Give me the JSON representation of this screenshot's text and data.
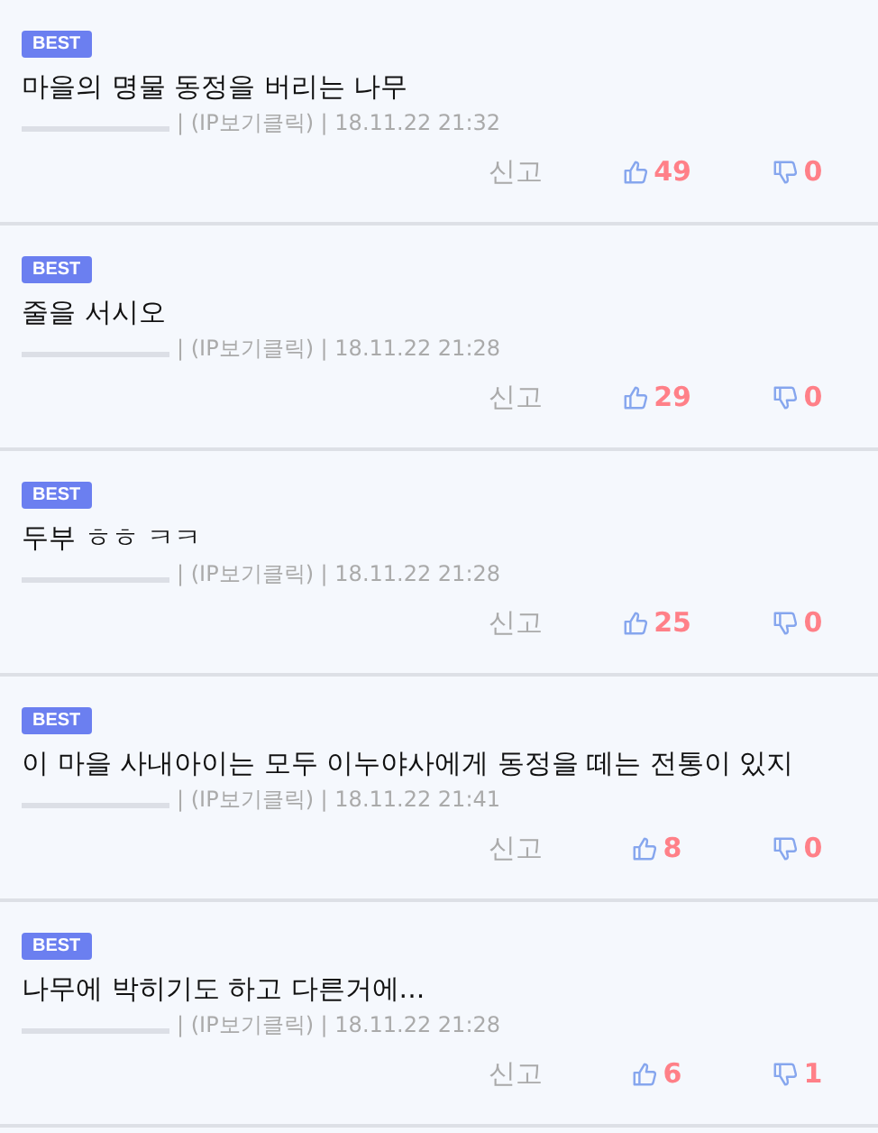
{
  "comments": [
    {
      "badge": "BEST",
      "text": "마을의 명물 동정을 버리는 나무",
      "meta": "| (IP보기클릭) | 18.11.22 21:32",
      "report": "신고",
      "likes": "49",
      "dislikes": "0"
    },
    {
      "badge": "BEST",
      "text": "줄을 서시오",
      "meta": "| (IP보기클릭) | 18.11.22 21:28",
      "report": "신고",
      "likes": "29",
      "dislikes": "0"
    },
    {
      "badge": "BEST",
      "text": "두부 ㅎㅎ ㅋㅋ",
      "meta": "| (IP보기클릭) | 18.11.22 21:28",
      "report": "신고",
      "likes": "25",
      "dislikes": "0"
    },
    {
      "badge": "BEST",
      "text": "이 마을 사내아이는 모두 이누야사에게 동정을 떼는 전통이 있지",
      "meta": "| (IP보기클릭) | 18.11.22 21:41",
      "report": "신고",
      "likes": "8",
      "dislikes": "0"
    },
    {
      "badge": "BEST",
      "text": "나무에 박히기도 하고 다른거에...",
      "meta": "| (IP보기클릭) | 18.11.22 21:28",
      "report": "신고",
      "likes": "6",
      "dislikes": "1"
    }
  ]
}
